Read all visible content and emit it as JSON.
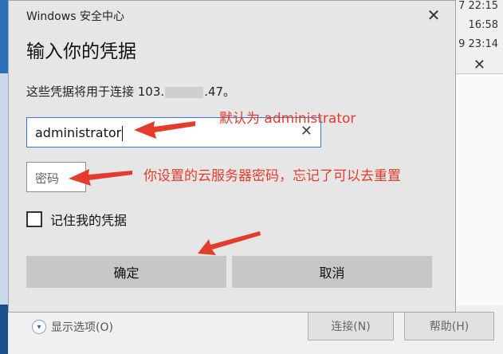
{
  "background_window": {
    "times": [
      "7 22:15",
      "16:58",
      "9 23:14"
    ],
    "connect_label": "连接(N)",
    "help_label": "帮助(H)",
    "options_label": "显示选项(O)"
  },
  "dialog": {
    "title": "Windows 安全中心",
    "heading": "输入你的凭据",
    "description_prefix": "这些凭据将用于连接 103.",
    "description_suffix": ".47。",
    "username_value": "administrator",
    "password_placeholder": "密码",
    "remember_label": "记住我的凭据",
    "ok_label": "确定",
    "cancel_label": "取消"
  },
  "annotations": {
    "username_note": "默认为 administrator",
    "password_note": "你设置的云服务器密码，忘记了可以去重置"
  },
  "colors": {
    "annotation": "#e53b2b",
    "focus_border": "#3b78d4"
  }
}
